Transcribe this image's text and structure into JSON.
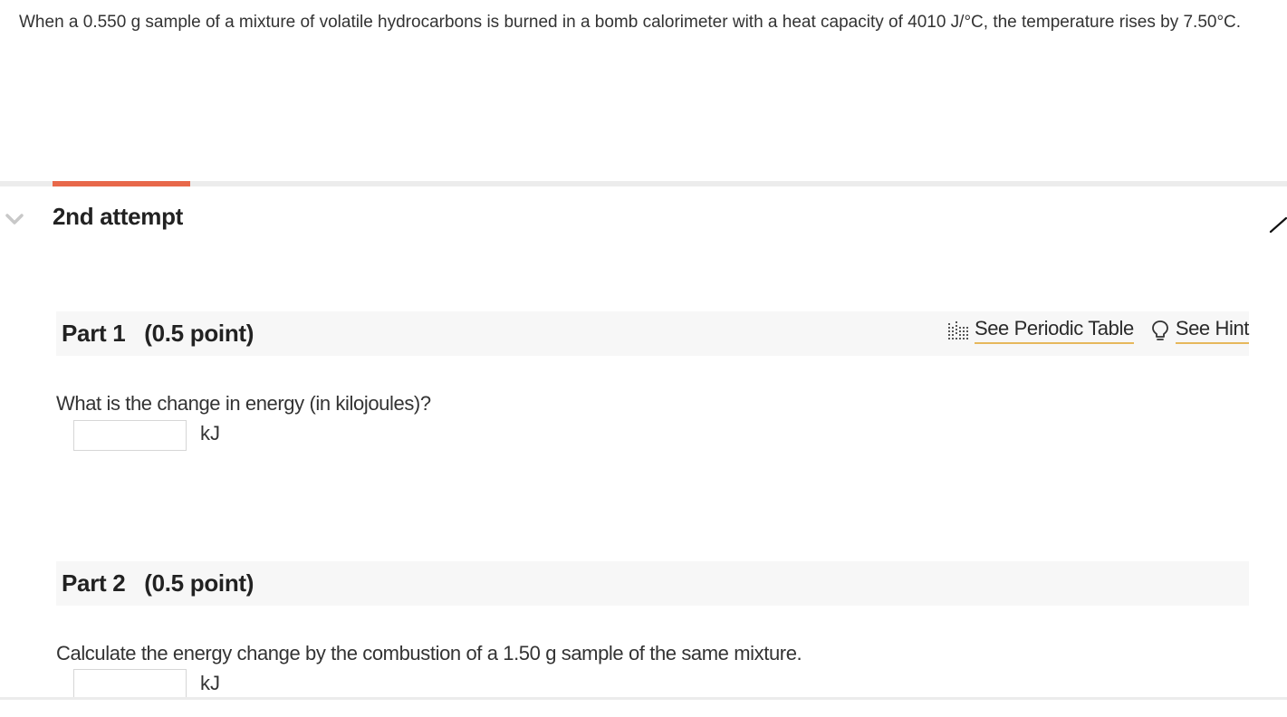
{
  "question": {
    "text": "When a 0.550 g sample of a mixture of volatile hydrocarbons is burned in a bomb calorimeter with a heat capacity of 4010 J/°C, the temperature rises by 7.50°C."
  },
  "attempt": {
    "title": "2nd attempt",
    "progress_fraction": 0.11
  },
  "tools": {
    "periodic_table_label": "See Periodic Table",
    "hint_label": "See Hint",
    "icons": [
      "periodic-table-icon",
      "lightbulb-icon"
    ],
    "underline_color": "#e6b85c"
  },
  "parts": [
    {
      "title": "Part 1   (0.5 point)",
      "prompt": "What is the change in energy (in kilojoules)?",
      "answer_value": "",
      "unit": "kJ"
    },
    {
      "title": "Part 2   (0.5 point)",
      "prompt": "Calculate the energy change by the combustion of a 1.50 g sample of the same mixture.",
      "answer_value": "",
      "unit": "kJ"
    }
  ],
  "colors": {
    "accent": "#e8684a",
    "header_bg": "#f7f7f7",
    "text": "#333333"
  }
}
